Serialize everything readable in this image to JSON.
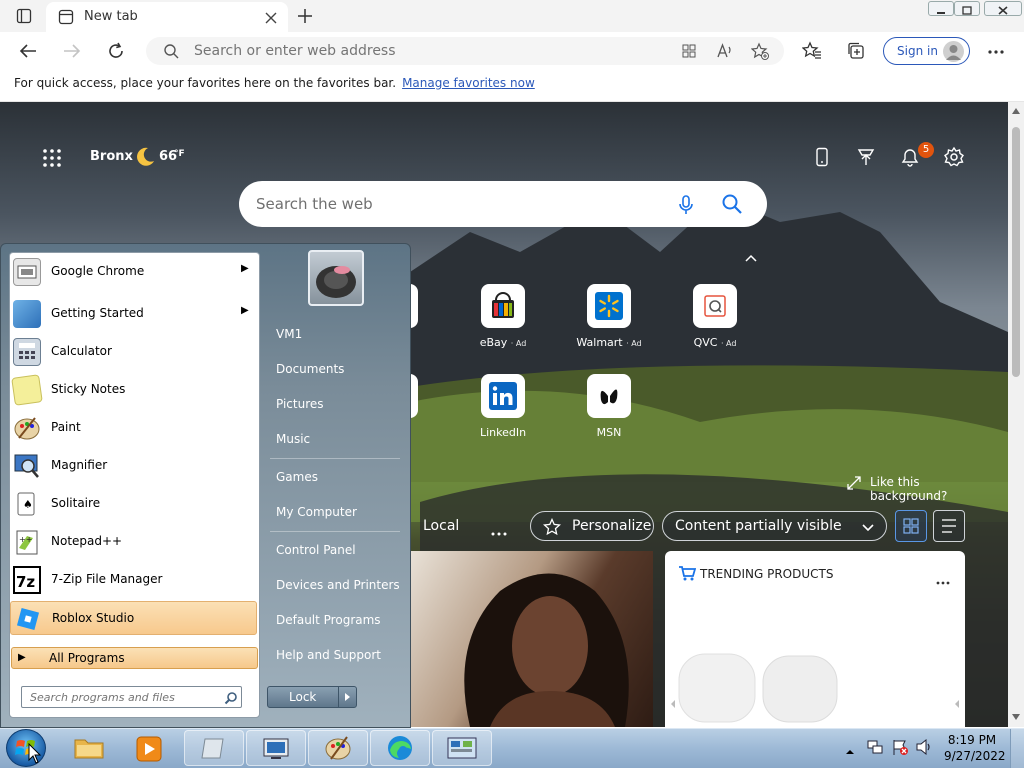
{
  "browser": {
    "tab_title": "New tab",
    "omnibox_placeholder": "Search or enter web address",
    "sign_in_label": "Sign in",
    "favorites_prompt": "For quick access, place your favorites here on the favorites bar.",
    "favorites_link": "Manage favorites now"
  },
  "newtab": {
    "location": "Bronx",
    "temperature": "66",
    "temp_unit": "°F",
    "notifications_count": "5",
    "search_placeholder": "Search the web",
    "tiles": [
      {
        "label": "eBay",
        "ad": "· Ad"
      },
      {
        "label": "Walmart",
        "ad": "· Ad"
      },
      {
        "label": "QVC",
        "ad": "· Ad"
      },
      {
        "label": "LinkedIn",
        "ad": ""
      },
      {
        "label": "MSN",
        "ad": ""
      }
    ],
    "like_background": "Like this background?",
    "feed_tab_local": "Local",
    "personalize_label": "Personalize",
    "content_visibility": "Content partially visible",
    "trending_title": "TRENDING PRODUCTS"
  },
  "start_menu": {
    "programs": [
      {
        "label": "Google Chrome",
        "submenu": true
      },
      {
        "label": "Getting Started",
        "submenu": true
      },
      {
        "label": "Calculator",
        "submenu": false
      },
      {
        "label": "Sticky Notes",
        "submenu": false
      },
      {
        "label": "Paint",
        "submenu": false
      },
      {
        "label": "Magnifier",
        "submenu": false
      },
      {
        "label": "Solitaire",
        "submenu": false
      },
      {
        "label": "Notepad++",
        "submenu": false
      },
      {
        "label": "7-Zip File Manager",
        "submenu": false
      },
      {
        "label": "Roblox Studio",
        "submenu": false
      }
    ],
    "all_programs": "All Programs",
    "search_placeholder": "Search programs and files",
    "right_items": [
      "VM1",
      "Documents",
      "Pictures",
      "Music",
      "Games",
      "My Computer",
      "Control Panel",
      "Devices and Printers",
      "Default Programs",
      "Help and Support"
    ],
    "lock_label": "Lock"
  },
  "taskbar": {
    "time": "8:19 PM",
    "date": "9/27/2022"
  }
}
